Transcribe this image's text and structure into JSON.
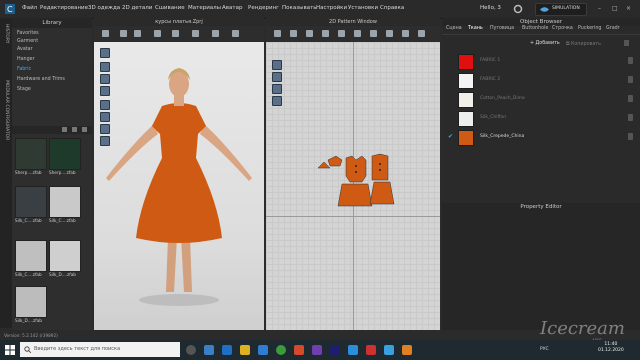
{
  "menu": {
    "items": [
      "Файл",
      "Редактирование",
      "3D одежда",
      "2D детали",
      "Сшивание",
      "Материалы",
      "Аватар",
      "Рендеринг",
      "Показывать",
      "Настройки",
      "Установки",
      "Справка"
    ],
    "user": "Hello, 3",
    "simulation": "SIMULATION"
  },
  "side_tabs": [
    "HISTORY",
    "MODULAR CONFIGURATOR"
  ],
  "library": {
    "title": "Library",
    "items": [
      "Favorites",
      "Garment",
      "Avatar",
      "Hanger",
      "Fabric",
      "Hardware and Trims",
      "Stage"
    ],
    "active_item": "Fabric",
    "thumbs": [
      {
        "label": "Sherp....zfab",
        "color": "#2f3a33"
      },
      {
        "label": "Sherp....zfab",
        "color": "#1e3a2a"
      },
      {
        "label": "Silk_C....zfab",
        "color": "#3a3f44"
      },
      {
        "label": "Silk_C....zfab",
        "color": "#c9c9c9"
      },
      {
        "label": "Silk_C....zfab",
        "color": "#bfbfbf"
      },
      {
        "label": "Silk_D....zfab",
        "color": "#cfcfcf"
      },
      {
        "label": "Silk_D....zfab",
        "color": "#bcbcbc"
      }
    ]
  },
  "view3d": {
    "title": "курсы платья.Zprj"
  },
  "view2d": {
    "title": "2D Pattern Window"
  },
  "object_browser": {
    "title": "Object Browser",
    "tabs": [
      "Сцена",
      "Ткань",
      "Пуговица",
      "Buttonhole",
      "Строчка",
      "Puckering",
      "Gradr"
    ],
    "active_tab": "Ткань",
    "add_label": "Добавить",
    "copy_label": "Копировать",
    "fabrics": [
      {
        "name": "FABRIC 1",
        "color": "#e01010",
        "selected": false
      },
      {
        "name": "FABRIC 2",
        "color": "#f4f4f4",
        "selected": false
      },
      {
        "name": "Cotton_Peach_Dima",
        "color": "#f2efe8",
        "selected": false
      },
      {
        "name": "Silk_Chiffon",
        "color": "#eeeeee",
        "selected": false
      },
      {
        "name": "Silk_Crepede_China",
        "color": "#cf5a14",
        "selected": true
      }
    ]
  },
  "property_editor": {
    "title": "Property Editor"
  },
  "status": {
    "version": "Version: 5.2.142 (r39892)"
  },
  "taskbar": {
    "search_placeholder": "Введите здесь текст для поиска",
    "tray_lang": "РУС",
    "time": "11:40",
    "date": "01.12.2020"
  },
  "watermark": {
    "brand": "Icecream",
    "sub": "APPS"
  },
  "colors": {
    "accent": "#4fa3e0",
    "dress": "#cf5a14"
  }
}
